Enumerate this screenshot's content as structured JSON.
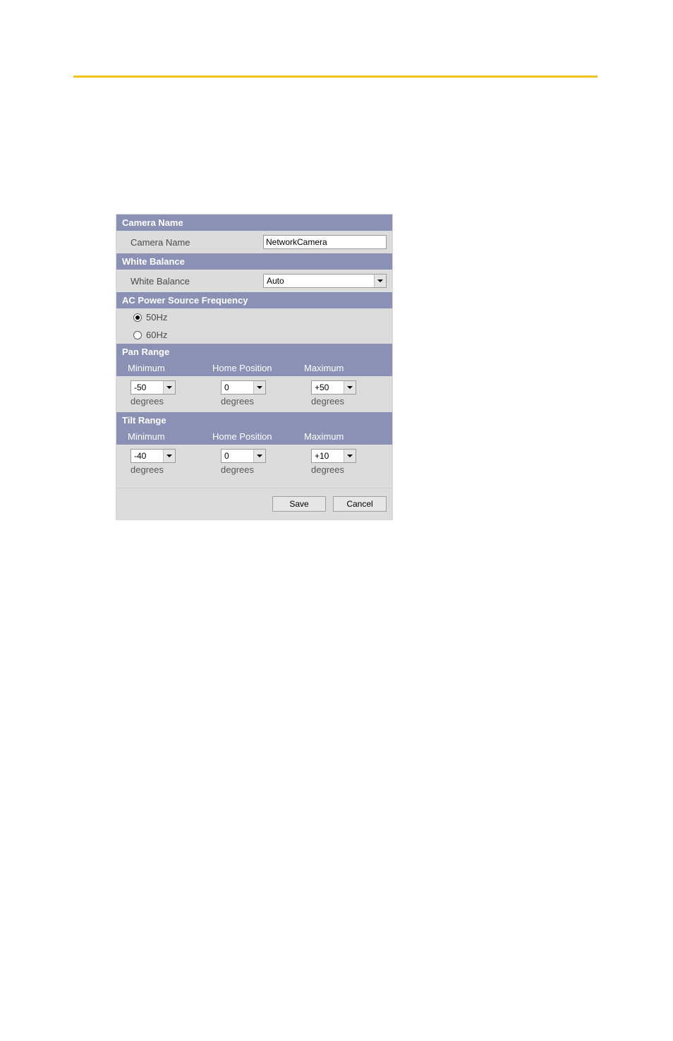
{
  "sections": {
    "cameraName": {
      "header": "Camera Name",
      "label": "Camera Name",
      "value": "NetworkCamera"
    },
    "whiteBalance": {
      "header": "White Balance",
      "label": "White Balance",
      "value": "Auto"
    },
    "acPower": {
      "header": "AC Power Source Frequency",
      "option1": "50Hz",
      "option2": "60Hz"
    },
    "panRange": {
      "header": "Pan Range",
      "col1": "Minimum",
      "col2": "Home Position",
      "col3": "Maximum",
      "minVal": "-50",
      "homeVal": "0",
      "maxVal": "+50",
      "unit": "degrees"
    },
    "tiltRange": {
      "header": "Tilt Range",
      "col1": "Minimum",
      "col2": "Home Position",
      "col3": "Maximum",
      "minVal": "-40",
      "homeVal": "0",
      "maxVal": "+10",
      "unit": "degrees"
    }
  },
  "buttons": {
    "save": "Save",
    "cancel": "Cancel"
  }
}
